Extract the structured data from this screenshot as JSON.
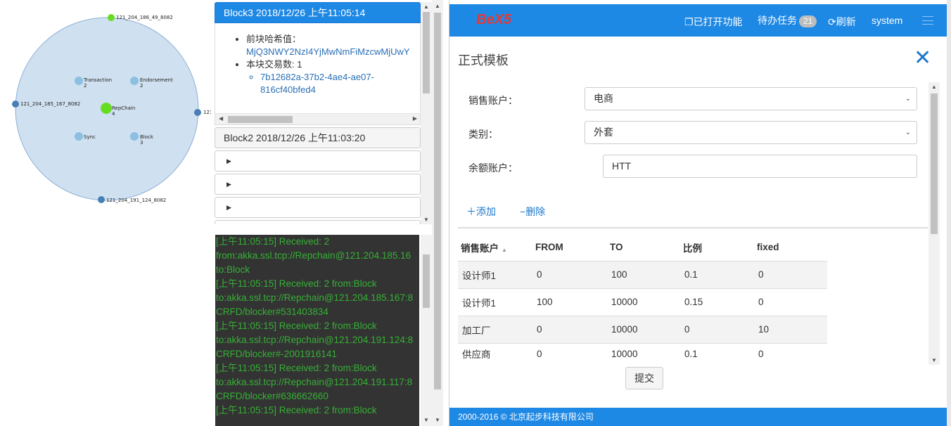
{
  "graph": {
    "nodes": {
      "top": "121_204_186_49_8082",
      "left": "121_204_185_167_8082",
      "right": "121_2",
      "bottom": "121_204_191_124_8082"
    },
    "modules": [
      {
        "name": "Transaction",
        "count": "2"
      },
      {
        "name": "Endorsement",
        "count": "2"
      },
      {
        "name": "RepChain",
        "count": "4"
      },
      {
        "name": "Sync",
        "count": ""
      },
      {
        "name": "Block",
        "count": "3"
      }
    ]
  },
  "blocks": {
    "active": {
      "title": "Block3 2018/12/26 上午11:05:14",
      "prev_hash_label": "前块哈希值：",
      "prev_hash": "MjQ3NWY2NzI4YjMwNmFiMzcwMjUwY",
      "tx_count_label": "本块交易数: 1",
      "tx_id": "7b12682a-37b2-4ae4-ae07-816cf40bfed4"
    },
    "second": "Block2 2018/12/26 上午11:03:20"
  },
  "log": [
    "[上午11:05:15] Received: 2",
    "from:akka.ssl.tcp://Repchain@121.204.185.16",
    "to:Block",
    "[上午11:05:15] Received: 2 from:Block",
    "to:akka.ssl.tcp://Repchain@121.204.185.167:8",
    "CRFD/blocker#531403834",
    "[上午11:05:15] Received: 2 from:Block",
    "to:akka.ssl.tcp://Repchain@121.204.191.124:8",
    "CRFD/blocker#-2001916141",
    "[上午11:05:15] Received: 2 from:Block",
    "to:akka.ssl.tcp://Repchain@121.204.191.117:8",
    "CRFD/blocker#636662660",
    "[上午11:05:15] Received: 2 from:Block"
  ],
  "app": {
    "logo": "BeX5",
    "opened": "已打开功能",
    "todo": "待办任务",
    "todo_count": "21",
    "refresh": "刷新",
    "user": "system",
    "dialog_title": "正式模板",
    "form": {
      "sales_label": "销售账户：",
      "sales_value": "电商",
      "category_label": "类别：",
      "category_value": "外套",
      "balance_label": "余额账户：",
      "balance_value": "HTT"
    },
    "add": "添加",
    "delete": "删除",
    "table": {
      "headers": [
        "销售账户",
        "FROM",
        "TO",
        "比例",
        "fixed"
      ],
      "rows": [
        [
          "设计师1",
          "0",
          "100",
          "0.1",
          "0"
        ],
        [
          "设计师1",
          "100",
          "10000",
          "0.15",
          "0"
        ],
        [
          "加工厂",
          "0",
          "10000",
          "0",
          "10"
        ],
        [
          "供应商",
          "0",
          "10000",
          "0.1",
          "0"
        ]
      ]
    },
    "submit": "提交",
    "footer": "2000-2016 © 北京起步科技有限公司"
  },
  "colors": {
    "accent": "#1e88e5",
    "graph_fill": "#cfe0f0",
    "node_green": "#66dd22",
    "node_blue": "#4a7fb5",
    "log_bg": "#333333",
    "log_text": "#35b035"
  }
}
